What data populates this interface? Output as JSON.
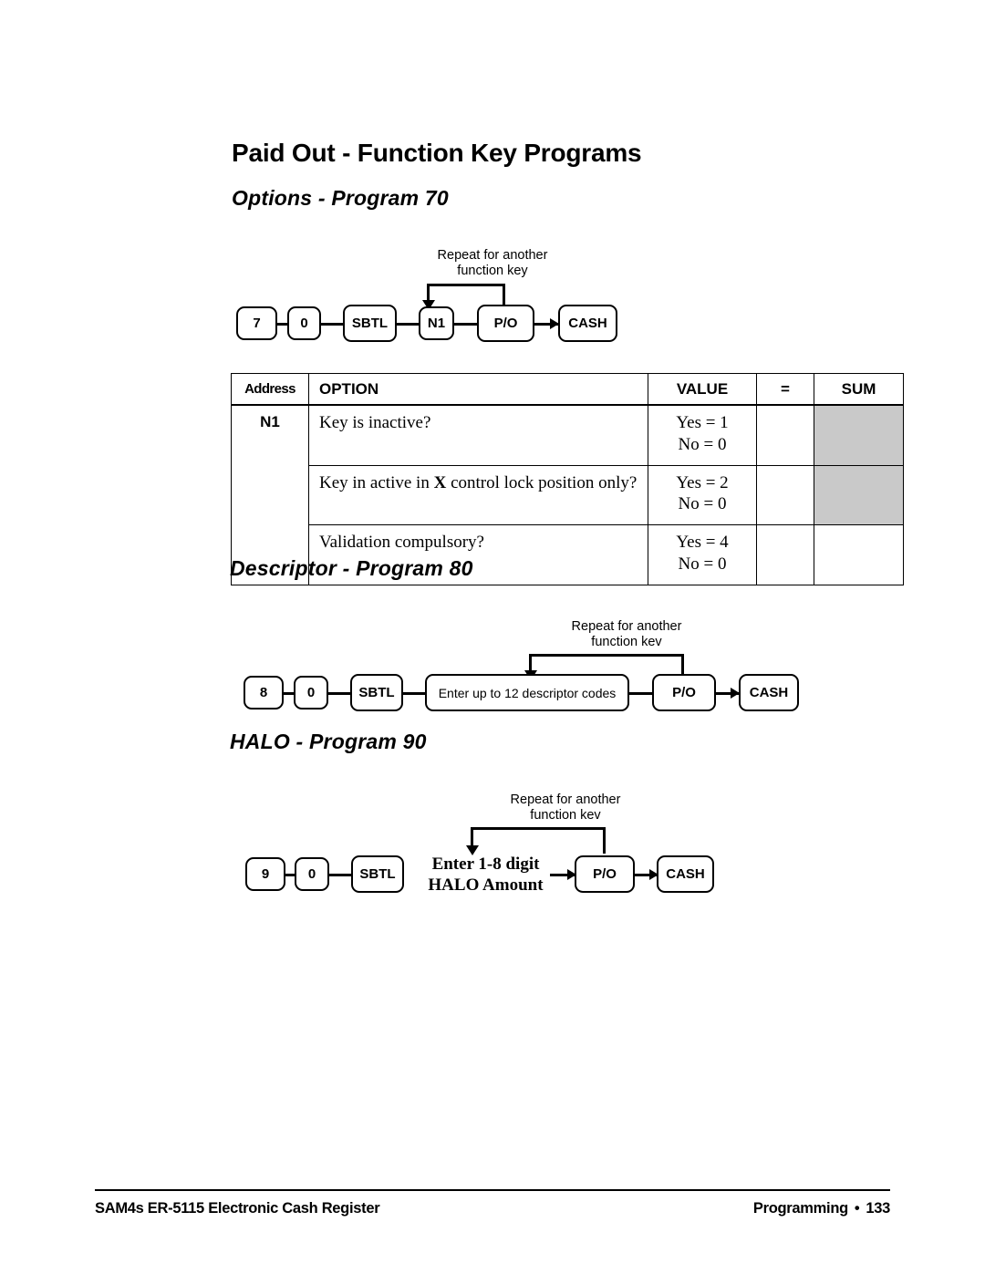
{
  "page": {
    "title": "Paid Out - Function Key Programs"
  },
  "sections": {
    "options": {
      "heading": "Options - Program 70",
      "flow": {
        "loop_caption_line1": "Repeat for another",
        "loop_caption_line2": "function key",
        "keys": [
          {
            "label": "7"
          },
          {
            "label": "0"
          },
          {
            "label": "SBTL"
          },
          {
            "label": "N1"
          },
          {
            "label": "P/O"
          },
          {
            "label": "CASH"
          }
        ]
      },
      "table": {
        "headers": [
          "Address",
          "OPTION",
          "VALUE",
          "=",
          "SUM"
        ],
        "address": "N1",
        "rows": [
          {
            "option_pre": "Key is inactive?",
            "option_bold": "",
            "option_post": "",
            "value_yes": "Yes = 1",
            "value_no": "No = 0",
            "eq": "",
            "sum": "",
            "sum_shaded": true
          },
          {
            "option_pre": "Key in active in ",
            "option_bold": "X",
            "option_post": " control lock position only?",
            "value_yes": "Yes = 2",
            "value_no": "No = 0",
            "eq": "",
            "sum": "",
            "sum_shaded": true
          },
          {
            "option_pre": "Validation compulsory?",
            "option_bold": "",
            "option_post": "",
            "value_yes": "Yes = 4",
            "value_no": "No = 0",
            "eq": "",
            "sum": "",
            "sum_shaded": false
          }
        ]
      }
    },
    "descriptor": {
      "heading": "Descriptor - Program 80",
      "flow": {
        "loop_caption_line1": "Repeat for another",
        "loop_caption_line2": "function kev",
        "keys": [
          {
            "label": "8"
          },
          {
            "label": "0"
          },
          {
            "label": "SBTL"
          },
          {
            "label": "Enter up to 12 descriptor codes"
          },
          {
            "label": "P/O"
          },
          {
            "label": "CASH"
          }
        ]
      }
    },
    "halo": {
      "heading": "HALO - Program 90",
      "flow": {
        "loop_caption_line1": "Repeat for another",
        "loop_caption_line2": "function kev",
        "keys": [
          {
            "label": "9"
          },
          {
            "label": "0"
          },
          {
            "label": "SBTL"
          },
          {
            "label": "P/O"
          },
          {
            "label": "CASH"
          }
        ],
        "plain_label_line1": "Enter 1-8 digit",
        "plain_label_line2": "HALO Amount"
      }
    }
  },
  "footer": {
    "left": "SAM4s ER-5115 Electronic Cash Register",
    "right_label": "Programming",
    "separator": "•",
    "page_number": "133"
  },
  "colors": {
    "ink": "#000000",
    "paper": "#ffffff",
    "sum_shade": "#c9c9c9"
  }
}
